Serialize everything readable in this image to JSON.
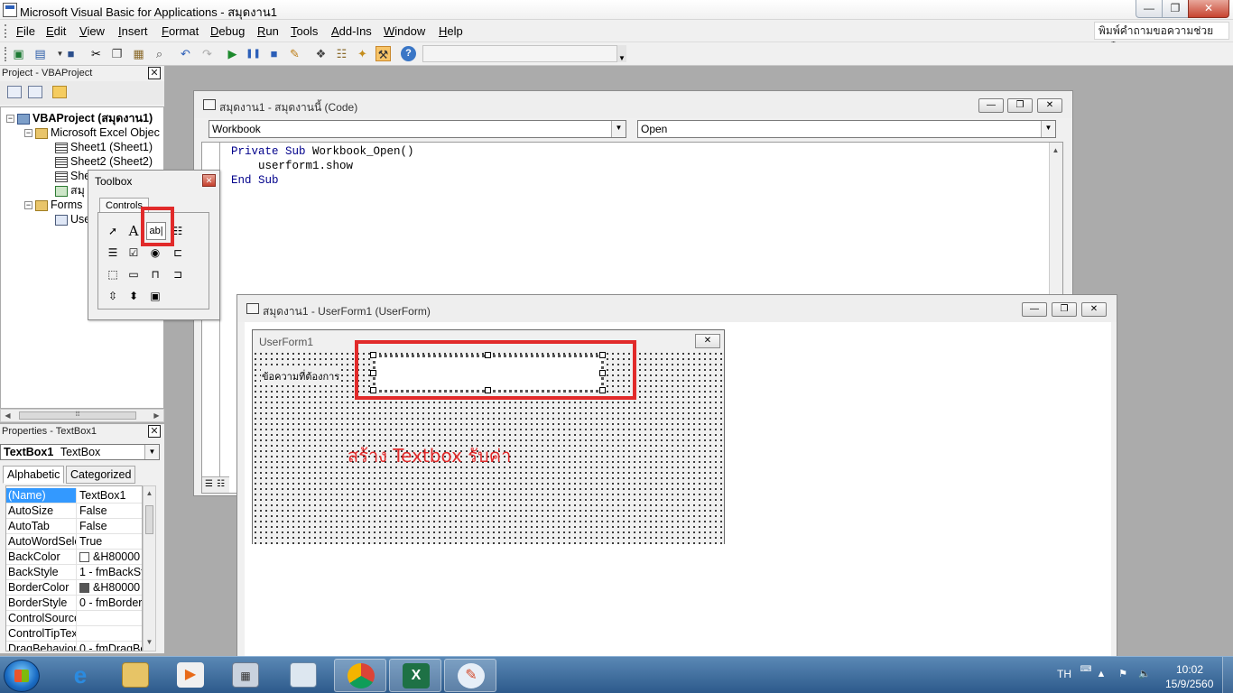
{
  "window": {
    "title": "Microsoft Visual Basic for Applications - สมุดงาน1",
    "minimize_glyph": "—",
    "maximize_glyph": "❐",
    "close_glyph": "✕"
  },
  "menu": {
    "items": [
      "File",
      "Edit",
      "View",
      "Insert",
      "Format",
      "Debug",
      "Run",
      "Tools",
      "Add-Ins",
      "Window",
      "Help"
    ],
    "help_search_placeholder": "พิมพ์คำถามขอความช่วยเหลือ"
  },
  "toolbar": {
    "icons": [
      "excel-view-icon",
      "insert-userform-icon",
      "save-icon",
      "cut-icon",
      "copy-icon",
      "paste-icon",
      "find-icon",
      "undo-icon",
      "redo-icon",
      "run-icon",
      "break-icon",
      "reset-icon",
      "design-mode-icon",
      "project-explorer-icon",
      "properties-window-icon",
      "object-browser-icon",
      "toolbox-icon",
      "help-icon"
    ]
  },
  "project_panel": {
    "title": "Project - VBAProject",
    "tree": {
      "project": "VBAProject (สมุดงาน1)",
      "excel_objects": "Microsoft Excel Objec",
      "sheet1": "Sheet1 (Sheet1)",
      "sheet2": "Sheet2 (Sheet2)",
      "sheet3_partial": "She",
      "workbook_partial": "สมุ",
      "forms": "Forms",
      "userform_partial": "Use"
    }
  },
  "properties_panel": {
    "title": "Properties - TextBox1",
    "object_name": "TextBox1",
    "object_type": "TextBox",
    "tabs": [
      "Alphabetic",
      "Categorized"
    ],
    "rows": [
      {
        "name": "(Name)",
        "value": "TextBox1"
      },
      {
        "name": "AutoSize",
        "value": "False"
      },
      {
        "name": "AutoTab",
        "value": "False"
      },
      {
        "name": "AutoWordSele",
        "value": "True"
      },
      {
        "name": "BackColor",
        "value": "&H80000"
      },
      {
        "name": "BackStyle",
        "value": "1 - fmBackSt"
      },
      {
        "name": "BorderColor",
        "value": "&H80000"
      },
      {
        "name": "BorderStyle",
        "value": "0 - fmBorder"
      },
      {
        "name": "ControlSource",
        "value": ""
      },
      {
        "name": "ControlTipTex",
        "value": ""
      },
      {
        "name": "DragBehavior",
        "value": "0 - fmDragBe"
      }
    ],
    "backcolor_swatch": "#ffffff",
    "bordercolor_swatch": "#555555"
  },
  "code_window": {
    "title": "สมุดงาน1 - สมุดงานนี้ (Code)",
    "object_combo": "Workbook",
    "procedure_combo": "Open",
    "lines": {
      "l1_kw": "Private Sub",
      "l1_rest": " Workbook_Open()",
      "l2": "    userform1.show",
      "l3_kw": "End Sub"
    }
  },
  "form_window": {
    "title": "สมุดงาน1 - UserForm1 (UserForm)",
    "userform_caption": "UserForm1",
    "label_text": "ข้อความที่ต้องการ",
    "annotation": "สร้าง Textbox รับค่า",
    "annotation_color": "#e12a2a"
  },
  "toolbox": {
    "title": "Toolbox",
    "tab": "Controls",
    "controls": [
      {
        "id": "select-objects",
        "glyph": "➚"
      },
      {
        "id": "label",
        "glyph": "A"
      },
      {
        "id": "textbox",
        "glyph": "ab|"
      },
      {
        "id": "combobox",
        "glyph": "☷"
      },
      {
        "id": "listbox",
        "glyph": "☰"
      },
      {
        "id": "checkbox",
        "glyph": "☑"
      },
      {
        "id": "optionbutton",
        "glyph": "◉"
      },
      {
        "id": "togglebutton",
        "glyph": "⊏"
      },
      {
        "id": "frame",
        "glyph": "⬚"
      },
      {
        "id": "commandbutton",
        "glyph": "▭"
      },
      {
        "id": "tabstrip",
        "glyph": "⊓"
      },
      {
        "id": "multipage",
        "glyph": "⊐"
      },
      {
        "id": "scrollbar",
        "glyph": "⇳"
      },
      {
        "id": "spinbutton",
        "glyph": "⬍"
      },
      {
        "id": "image",
        "glyph": "▣"
      }
    ]
  },
  "taskbar": {
    "apps": [
      "internet-explorer-icon",
      "file-explorer-icon",
      "media-player-icon",
      "calculator-icon",
      "notepad-icon",
      "chrome-icon",
      "excel-icon",
      "paint-icon"
    ],
    "language": "TH",
    "time": "10:02",
    "date": "15/9/2560"
  }
}
